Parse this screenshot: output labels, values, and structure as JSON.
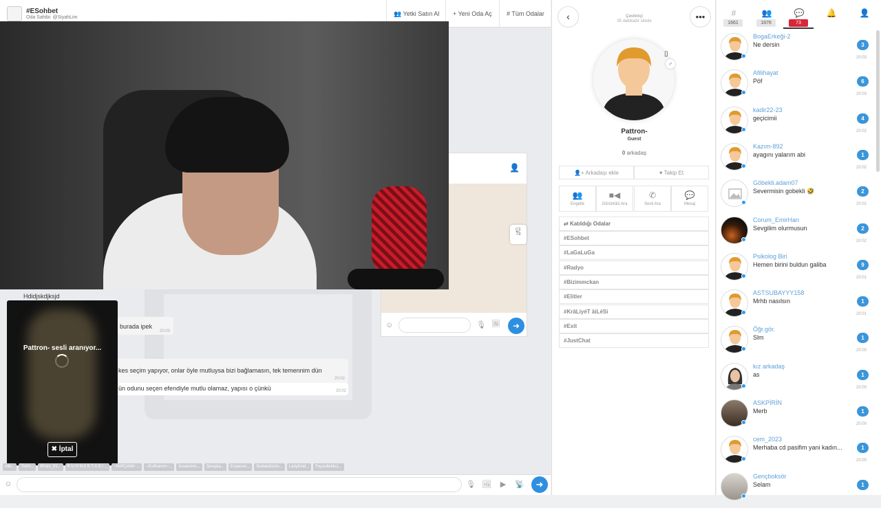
{
  "header": {
    "room_title": "#ESohbet",
    "room_owner": "Oda Sahibi: @SiyahLim",
    "buttons": [
      "Yetki Satın Al",
      "Yeni Oda Aç",
      "Tüm Odalar"
    ]
  },
  "chat": {
    "messages": [
      {
        "text": "Hdidjskdjksjd",
        "time": "20:03"
      },
      {
        "text": "burada ipek",
        "time": "20:03"
      },
      {
        "text": "kes seçim yapıyor, onlar öyle mutluysa bizi bağlamasın, tek temennim dün",
        "time": "20:02"
      },
      {
        "text": "ün odunu seçen efendiyle mutlu olamaz, yapısı o çünkü",
        "time": "20:02"
      }
    ],
    "pm_badge": "73",
    "room_tags": [
      "nile...",
      "Trem...",
      "M'ses_01...",
      "R U H N A S T A S I ...",
      "~HıRÇıNM~...",
      "~Evilhanım~...",
      "İnsanımm...",
      "Şivaşka...",
      "Esşenon...",
      "Sodakdüzün...",
      "Ladyfünd...",
      "Feyzullahkız..."
    ]
  },
  "call": {
    "status_text": "Pattron- sesli aranıyor...",
    "cancel_label": "İptal"
  },
  "profile": {
    "online_status": "Çevrimiçi",
    "online_time": "35 dakikadır sitede",
    "name": "Pattron-",
    "role": "Guest",
    "friends_count": "0",
    "friends_label": "arkadaş",
    "add_friend_label": "Arkadaşı ekle",
    "follow_label": "Takip Et",
    "actions": [
      "Engelle",
      "Görüntülü Ara",
      "Sesli Ara",
      "Mesaj"
    ],
    "rooms_header": "Katıldığı Odalar",
    "rooms": [
      "#ESohbet",
      "#LaGaLuGa",
      "#Radyo",
      "#Bizimmckan",
      "#Elitler",
      "#KrâLiyéT âiLéSi",
      "#Exit",
      "#JustChat"
    ]
  },
  "tabs": {
    "rooms_count": "1661",
    "users_count": "1876",
    "messages_count": "73"
  },
  "conversations": [
    {
      "name": "BogaErkeği-2",
      "text": "Ne dersin",
      "badge": "3",
      "time": "20:03",
      "avatar": "man"
    },
    {
      "name": "Afilihayat",
      "text": "Pöf",
      "badge": "6",
      "time": "20:03",
      "avatar": "man"
    },
    {
      "name": "kadir22-23",
      "text": "geçicimii",
      "badge": "4",
      "time": "20:02",
      "avatar": "man"
    },
    {
      "name": "Kazım-892",
      "text": "ayagını yalarım abi",
      "badge": "1",
      "time": "20:02",
      "avatar": "man"
    },
    {
      "name": "Göbekli.adam07",
      "text": "Severmisin gobekli 🤣",
      "badge": "2",
      "time": "20:02",
      "avatar": "image"
    },
    {
      "name": "Corum_EmirHan",
      "text": "Sevgilim olurmusun",
      "badge": "2",
      "time": "20:02",
      "avatar": "photo-dark"
    },
    {
      "name": "Psikolog Biri",
      "text": "Hemen birini buldun galiba",
      "badge": "9",
      "time": "20:01",
      "avatar": "man"
    },
    {
      "name": "ASTSUBAYYY158",
      "text": "Mrhb nasılsın",
      "badge": "1",
      "time": "20:01",
      "avatar": "man"
    },
    {
      "name": "Öğr.gör.",
      "text": "Slm",
      "badge": "1",
      "time": "20:00",
      "avatar": "man"
    },
    {
      "name": "kız arkadaş",
      "text": "as",
      "badge": "1",
      "time": "20:00",
      "avatar": "woman"
    },
    {
      "name": "ASKPİRİN",
      "text": "Merb",
      "badge": "1",
      "time": "20:00",
      "avatar": "photo"
    },
    {
      "name": "cem_2023",
      "text": "Merhaba cd pasifim yani kadın...",
      "badge": "1",
      "time": "20:00",
      "avatar": "man"
    },
    {
      "name": "Gençboksör",
      "text": "Selam",
      "badge": "1",
      "time": "",
      "avatar": "photo-light"
    }
  ]
}
